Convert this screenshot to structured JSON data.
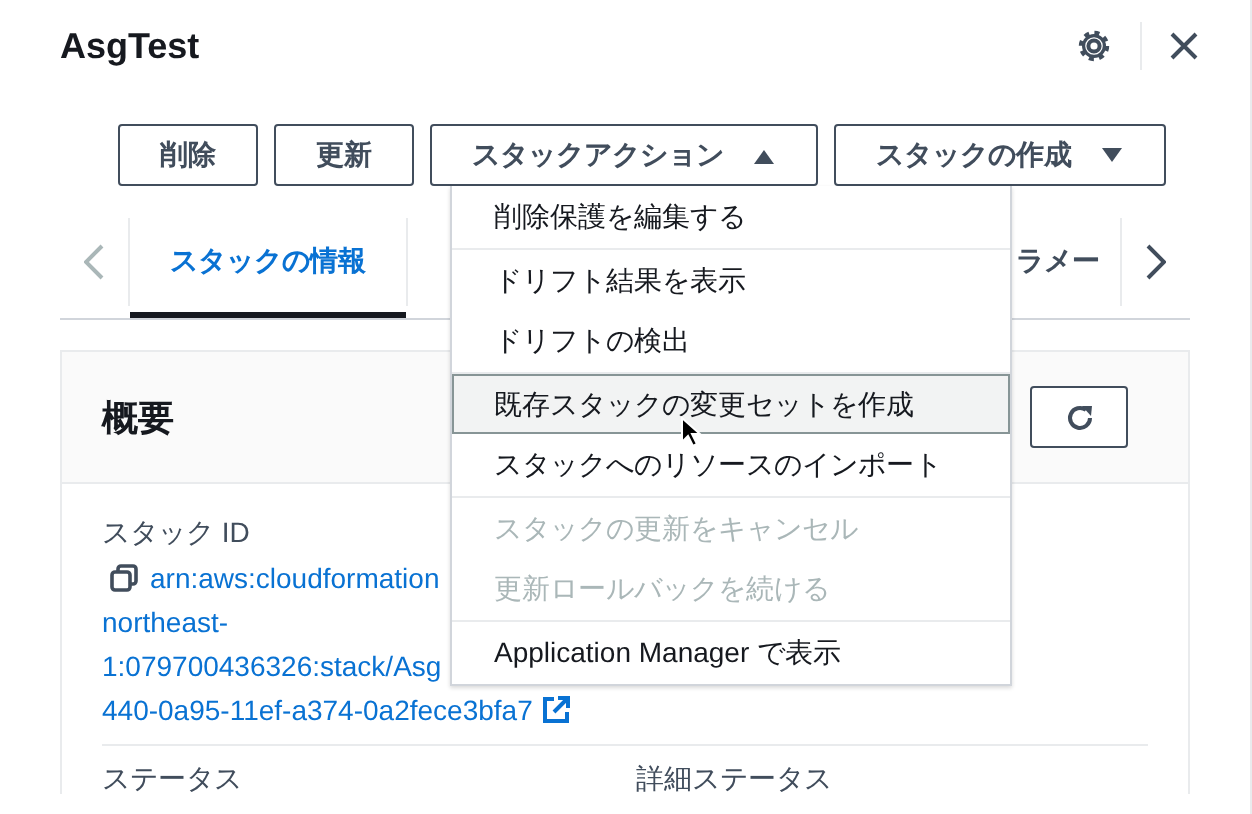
{
  "panel": {
    "title": "AsgTest"
  },
  "actions": [
    {
      "label": "削除",
      "kind": "plain"
    },
    {
      "label": "更新",
      "kind": "plain"
    },
    {
      "label": "スタックアクション",
      "kind": "dropdown",
      "expanded": true
    },
    {
      "label": "スタックの作成",
      "kind": "dropdown",
      "expanded": false
    }
  ],
  "tabs": [
    {
      "label": "スタックの情報",
      "selected": true
    },
    {
      "label": "ラメー",
      "selected": false
    }
  ],
  "action_menu": {
    "groups": [
      {
        "items": [
          {
            "label": "削除保護を編集する",
            "highlighted": false,
            "disabled": false
          }
        ]
      },
      {
        "items": [
          {
            "label": "ドリフト結果を表示",
            "highlighted": false,
            "disabled": false
          },
          {
            "label": "ドリフトの検出",
            "highlighted": false,
            "disabled": false
          }
        ]
      },
      {
        "items": [
          {
            "label": "既存スタックの変更セットを作成",
            "highlighted": true,
            "disabled": false
          },
          {
            "label": "スタックへのリソースのインポート",
            "highlighted": false,
            "disabled": false
          }
        ]
      },
      {
        "items": [
          {
            "label": "スタックの更新をキャンセル",
            "highlighted": false,
            "disabled": true
          },
          {
            "label": "更新ロールバックを続ける",
            "highlighted": false,
            "disabled": true
          }
        ]
      },
      {
        "items": [
          {
            "label": "Application Manager で表示",
            "highlighted": false,
            "disabled": false
          }
        ]
      }
    ]
  },
  "overview": {
    "title": "概要",
    "stack_id_label": "スタック ID",
    "stack_id_lines": [
      "arn:aws:cloudformation",
      "northeast-",
      "1:079700436326:stack/Asg",
      "440-0a95-11ef-a374-0a2fece3bfa7"
    ],
    "fields": [
      {
        "label": "ステータス"
      },
      {
        "label": "詳細ステータス"
      }
    ]
  }
}
